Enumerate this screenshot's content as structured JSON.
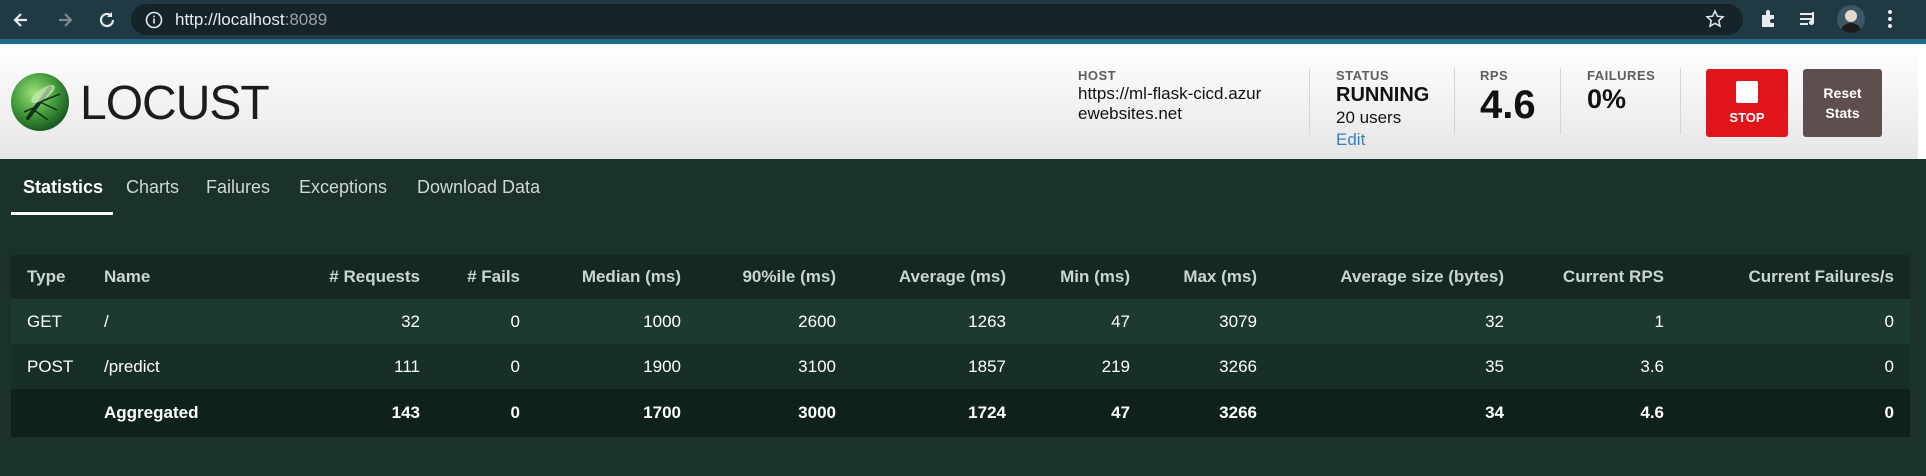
{
  "browser": {
    "url_host": "http://localhost",
    "url_port": ":8089"
  },
  "header": {
    "logo_text": "LOCUST",
    "host_label": "HOST",
    "host_value": "https://ml-flask-cicd.azurewebsites.net",
    "status_label": "STATUS",
    "status_value": "RUNNING",
    "users_value": "20 users",
    "edit_label": "Edit",
    "rps_label": "RPS",
    "rps_value": "4.6",
    "failures_label": "FAILURES",
    "failures_value": "0%",
    "stop_label": "STOP",
    "reset_label_1": "Reset",
    "reset_label_2": "Stats"
  },
  "tabs": [
    {
      "label": "Statistics",
      "active": true
    },
    {
      "label": "Charts",
      "active": false
    },
    {
      "label": "Failures",
      "active": false
    },
    {
      "label": "Exceptions",
      "active": false
    },
    {
      "label": "Download Data",
      "active": false
    }
  ],
  "table": {
    "columns": [
      "Type",
      "Name",
      "# Requests",
      "# Fails",
      "Median (ms)",
      "90%ile (ms)",
      "Average (ms)",
      "Min (ms)",
      "Max (ms)",
      "Average size (bytes)",
      "Current RPS",
      "Current Failures/s"
    ],
    "rows": [
      [
        "GET",
        "/",
        "32",
        "0",
        "1000",
        "2600",
        "1263",
        "47",
        "3079",
        "32",
        "1",
        "0"
      ],
      [
        "POST",
        "/predict",
        "111",
        "0",
        "1900",
        "3100",
        "1857",
        "219",
        "3266",
        "35",
        "3.6",
        "0"
      ]
    ],
    "aggregated": [
      "",
      "Aggregated",
      "143",
      "0",
      "1700",
      "3000",
      "1724",
      "47",
      "3266",
      "34",
      "4.6",
      "0"
    ]
  },
  "colors": {
    "page_bg": "#1a3228",
    "stop_button": "#e0141b",
    "reset_button": "#5e4f4f",
    "edit_link": "#2f85c4"
  }
}
